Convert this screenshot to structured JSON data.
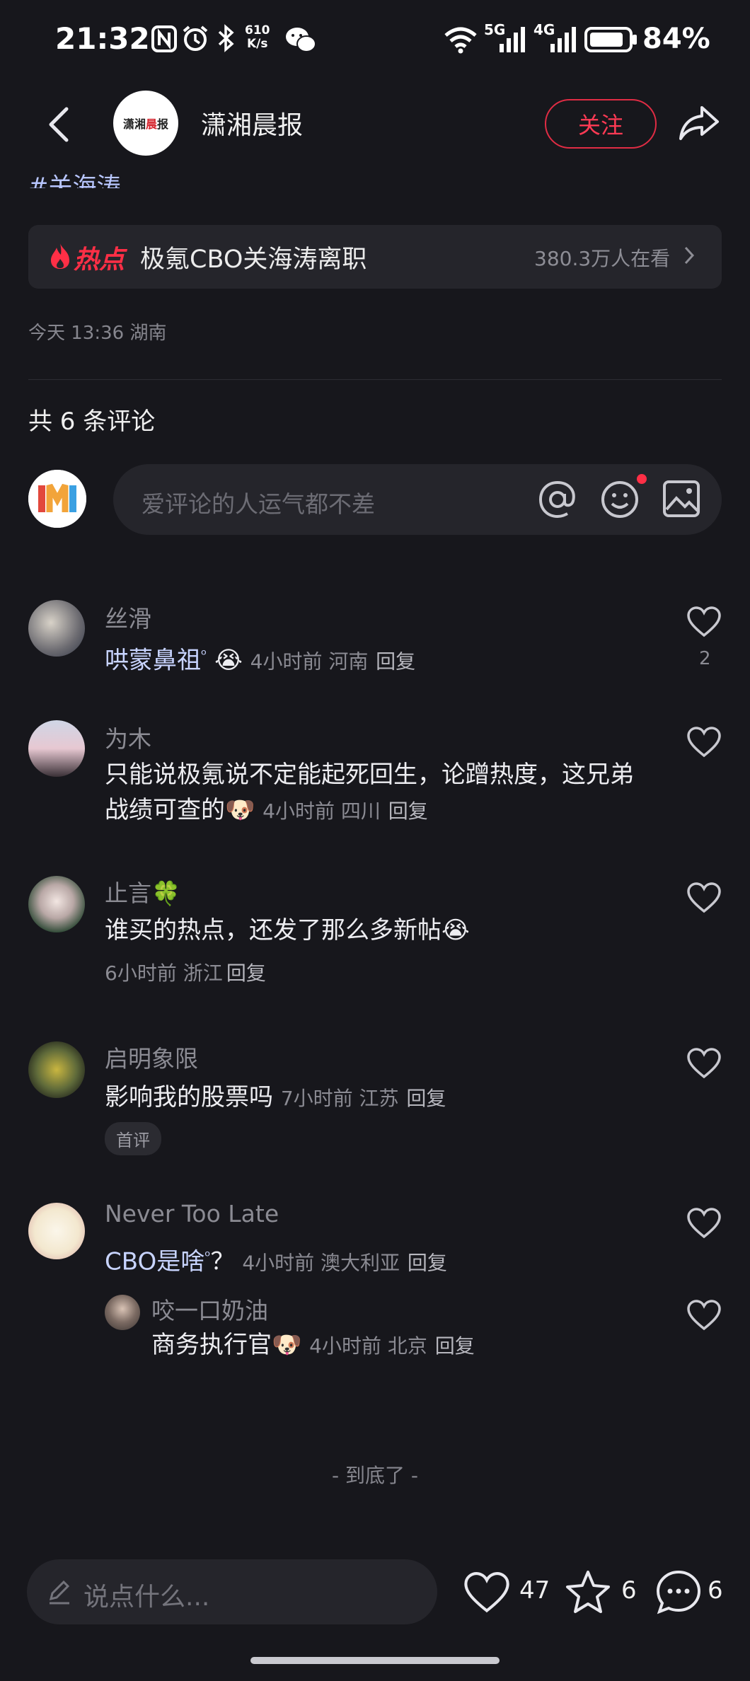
{
  "status_bar": {
    "time": "21:32",
    "net_speed_top": "610",
    "net_speed_bottom": "K/s",
    "net_5g": "5G",
    "net_4g": "4G",
    "battery": "84%"
  },
  "header": {
    "account_name": "潇湘晨报",
    "logo_text_a": "潇湘",
    "logo_text_b": "晨",
    "logo_text_c": "报",
    "follow_label": "关注"
  },
  "post": {
    "hashtag": "#关海涛",
    "hot_label": "热点",
    "hot_title": "极氪CBO关海涛离职",
    "hot_watching": "380.3万人在看",
    "date_location": "今天 13:36 湖南"
  },
  "comments_section": {
    "count_label": "共 6 条评论",
    "input_placeholder": "爱评论的人运气都不差",
    "end_label": "- 到底了 -",
    "items": [
      {
        "name": "丝滑",
        "text": "哄蒙鼻祖",
        "emoji": "😭",
        "meta": "4小时前 河南",
        "reply": "回复",
        "likes": "2"
      },
      {
        "name": "为木",
        "text": "只能说极氪说不定能起死回生，论蹭热度，这兄弟战绩可查的",
        "emoji": "🐶",
        "meta": "4小时前 四川",
        "reply": "回复"
      },
      {
        "name": "止言",
        "name_emoji": "🍀",
        "text": "谁买的热点，还发了那么多新帖",
        "emoji": "😭",
        "meta": "6小时前 浙江",
        "reply": "回复"
      },
      {
        "name": "启明象限",
        "text": "影响我的股票吗",
        "meta": "7小时前 江苏",
        "reply": "回复",
        "badge": "首评"
      },
      {
        "name": "Never Too Late",
        "text": "CBO是啥",
        "suffix": "？",
        "meta": "4小时前 澳大利亚",
        "reply": "回复"
      }
    ],
    "sub_reply": {
      "name": "咬一口奶油",
      "text": "商务执行官",
      "emoji": "🐶",
      "meta": "4小时前 北京",
      "reply": "回复"
    }
  },
  "bottom_bar": {
    "say_placeholder": "说点什么...",
    "likes": "47",
    "favorites": "6",
    "comments": "6"
  }
}
